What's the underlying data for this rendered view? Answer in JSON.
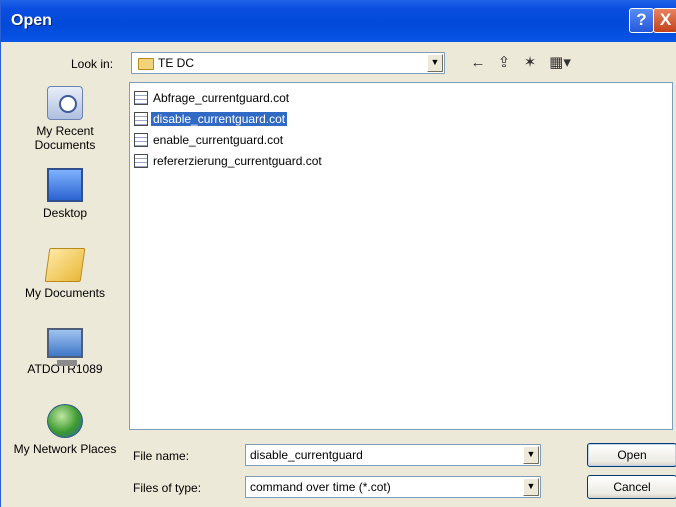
{
  "window": {
    "title": "Open"
  },
  "titlebar": {
    "help": "?",
    "close": "X"
  },
  "lookin": {
    "label": "Look in:",
    "value": "TE DC"
  },
  "toolbar": {
    "back": "←",
    "up": "⇪",
    "new_folder": "✶",
    "views": "▦▾"
  },
  "places": [
    {
      "label": "My Recent Documents",
      "icon": "recent-documents-icon"
    },
    {
      "label": "Desktop",
      "icon": "desktop-icon"
    },
    {
      "label": "My Documents",
      "icon": "my-documents-icon"
    },
    {
      "label": "ATDOTR1089",
      "icon": "my-computer-icon"
    },
    {
      "label": "My Network Places",
      "icon": "network-places-icon"
    }
  ],
  "files": [
    {
      "name": "Abfrage_currentguard.cot",
      "selected": false
    },
    {
      "name": "disable_currentguard.cot",
      "selected": true
    },
    {
      "name": "enable_currentguard.cot",
      "selected": false
    },
    {
      "name": "refererzierung_currentguard.cot",
      "selected": false
    }
  ],
  "filename": {
    "label": "File name:",
    "value": "disable_currentguard"
  },
  "filetype": {
    "label": "Files of type:",
    "value": "command over time  (*.cot)"
  },
  "buttons": {
    "open": "Open",
    "cancel": "Cancel"
  },
  "colors": {
    "titlebar": "#0a4ee0",
    "selection": "#316ac5",
    "dialog_bg": "#ece9d8"
  }
}
